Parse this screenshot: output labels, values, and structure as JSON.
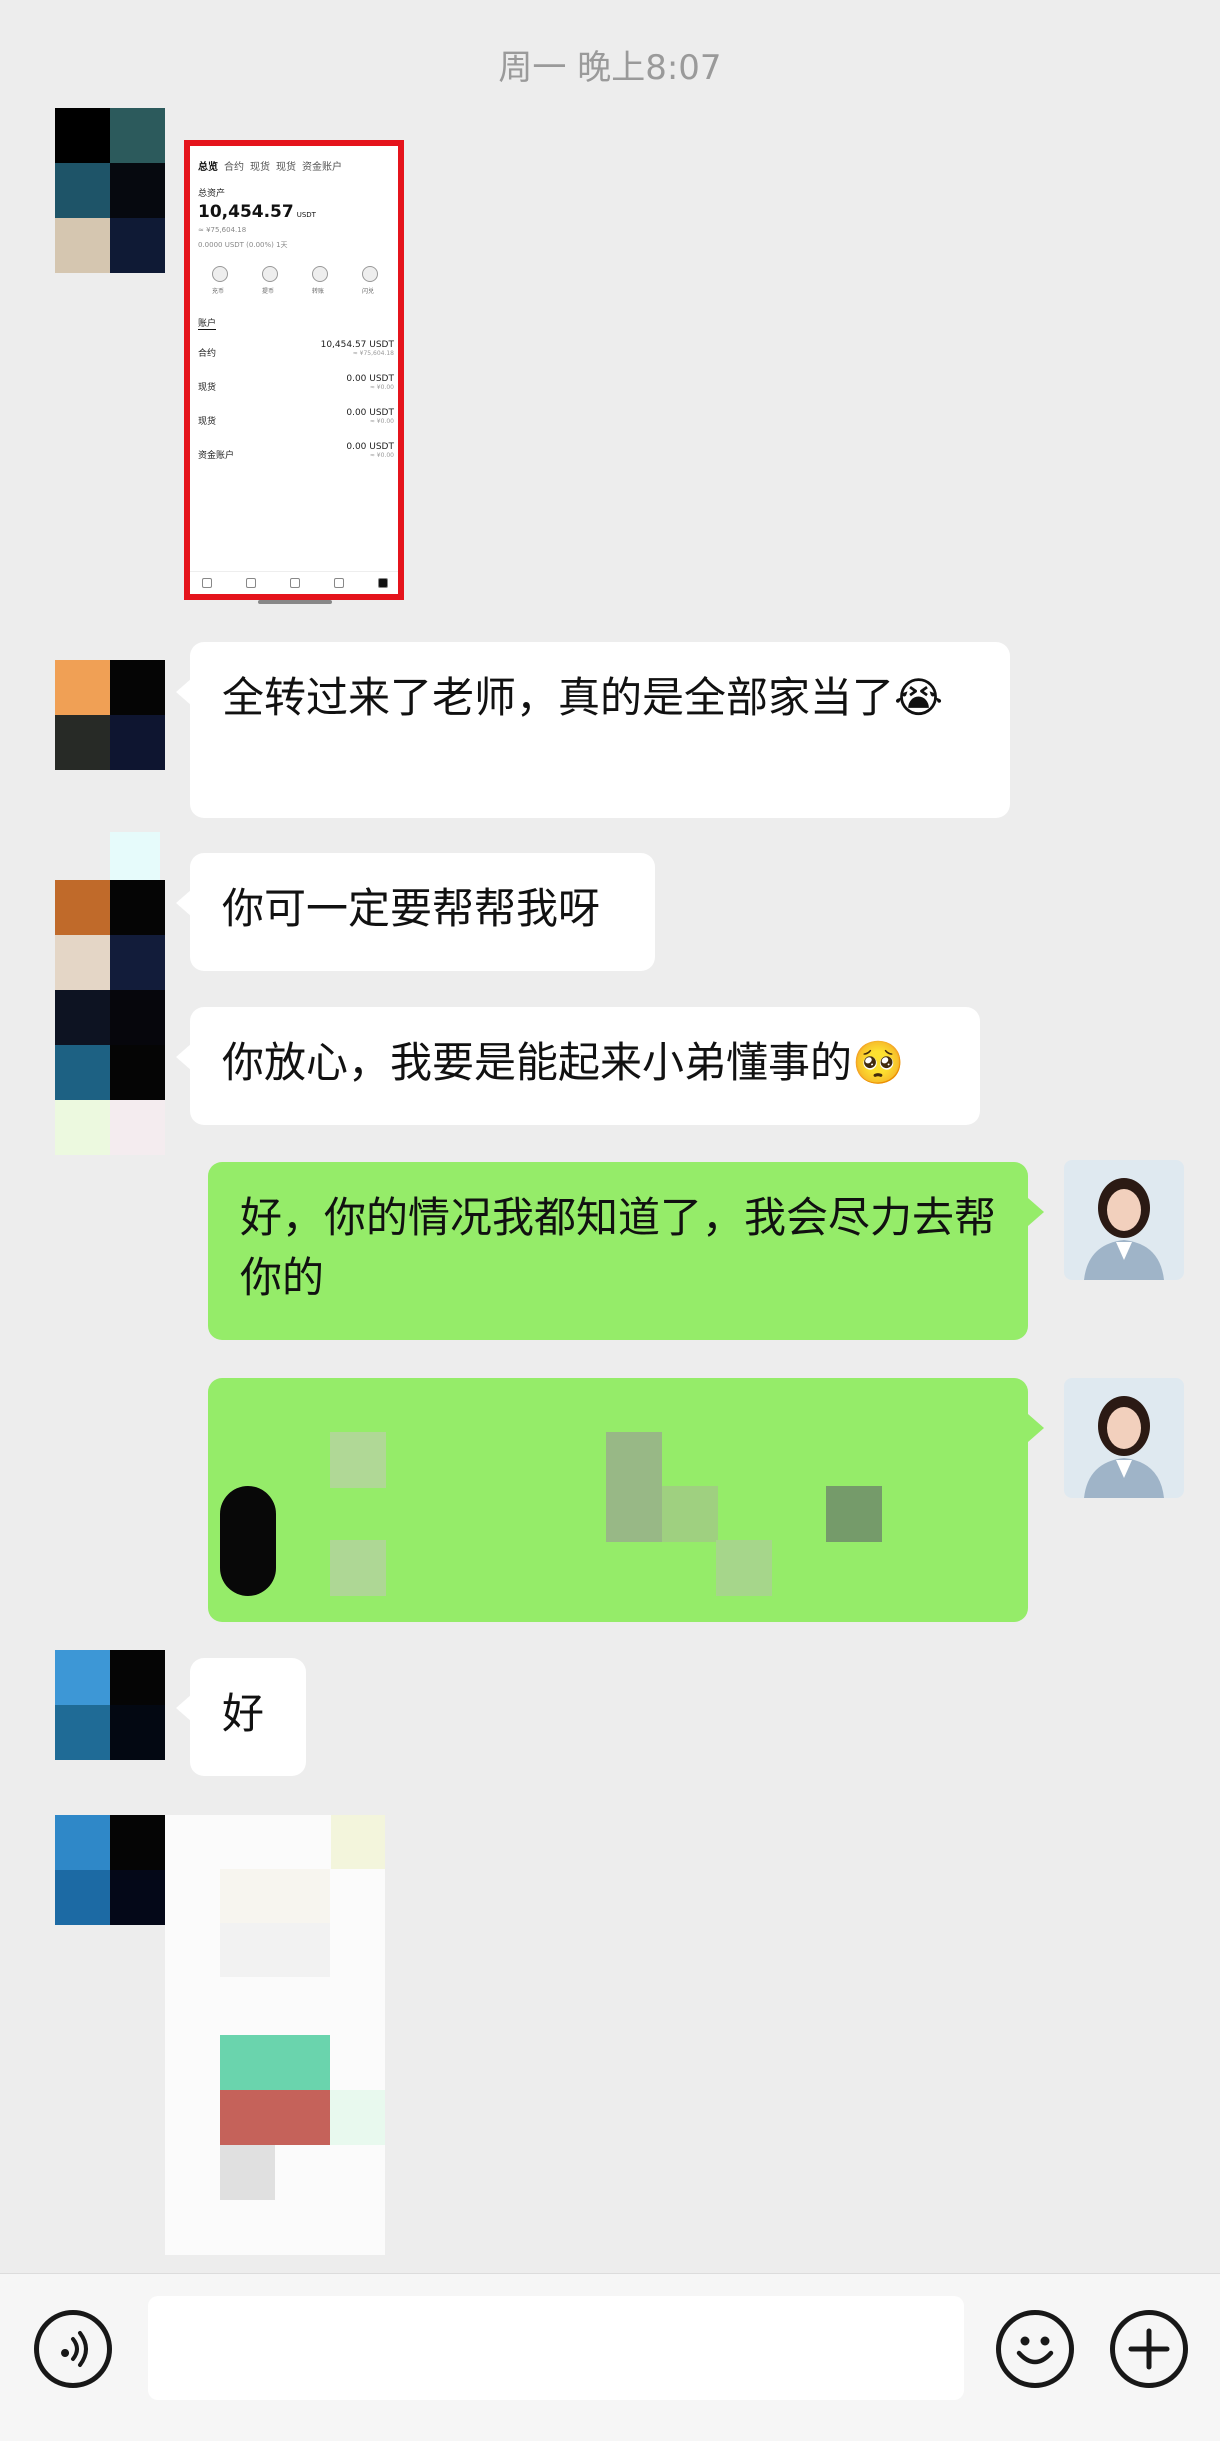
{
  "timestamp": "周一 晚上8:07",
  "shared_screenshot": {
    "tabs": [
      "总览",
      "合约",
      "现货",
      "现货",
      "资金账户"
    ],
    "total_label": "总资产",
    "total_value": "10,454.57",
    "total_unit": "USDT",
    "cny_line": "≈ ¥75,604.18",
    "pnl_line": "0.0000 USDT (0.00%) 1天",
    "actions": [
      "充币",
      "提币",
      "转账",
      "闪兑"
    ],
    "section_label": "账户",
    "accounts": [
      {
        "name": "合约",
        "value": "10,454.57 USDT",
        "sub": "≈ ¥75,604.18"
      },
      {
        "name": "现货",
        "value": "0.00 USDT",
        "sub": "≈ ¥0.00"
      },
      {
        "name": "现货",
        "value": "0.00 USDT",
        "sub": "≈ ¥0.00"
      },
      {
        "name": "资金账户",
        "value": "0.00 USDT",
        "sub": "≈ ¥0.00"
      }
    ]
  },
  "messages": {
    "m1": "全转过来了老师，真的是全部家当了😭",
    "m2": "你可一定要帮帮我呀",
    "m3": "你放心，我要是能起来小弟懂事的🥺",
    "m4": "好，你的情况我都知道了，我会尽力去帮你的",
    "m6": "好"
  },
  "colors": {
    "background": "#ededed",
    "outgoing_bubble": "#95ec69",
    "incoming_bubble": "#ffffff",
    "highlight_border": "#e5141c"
  },
  "icons": {
    "voice": "voice-icon",
    "emoji": "emoji-icon",
    "plus": "plus-icon"
  }
}
